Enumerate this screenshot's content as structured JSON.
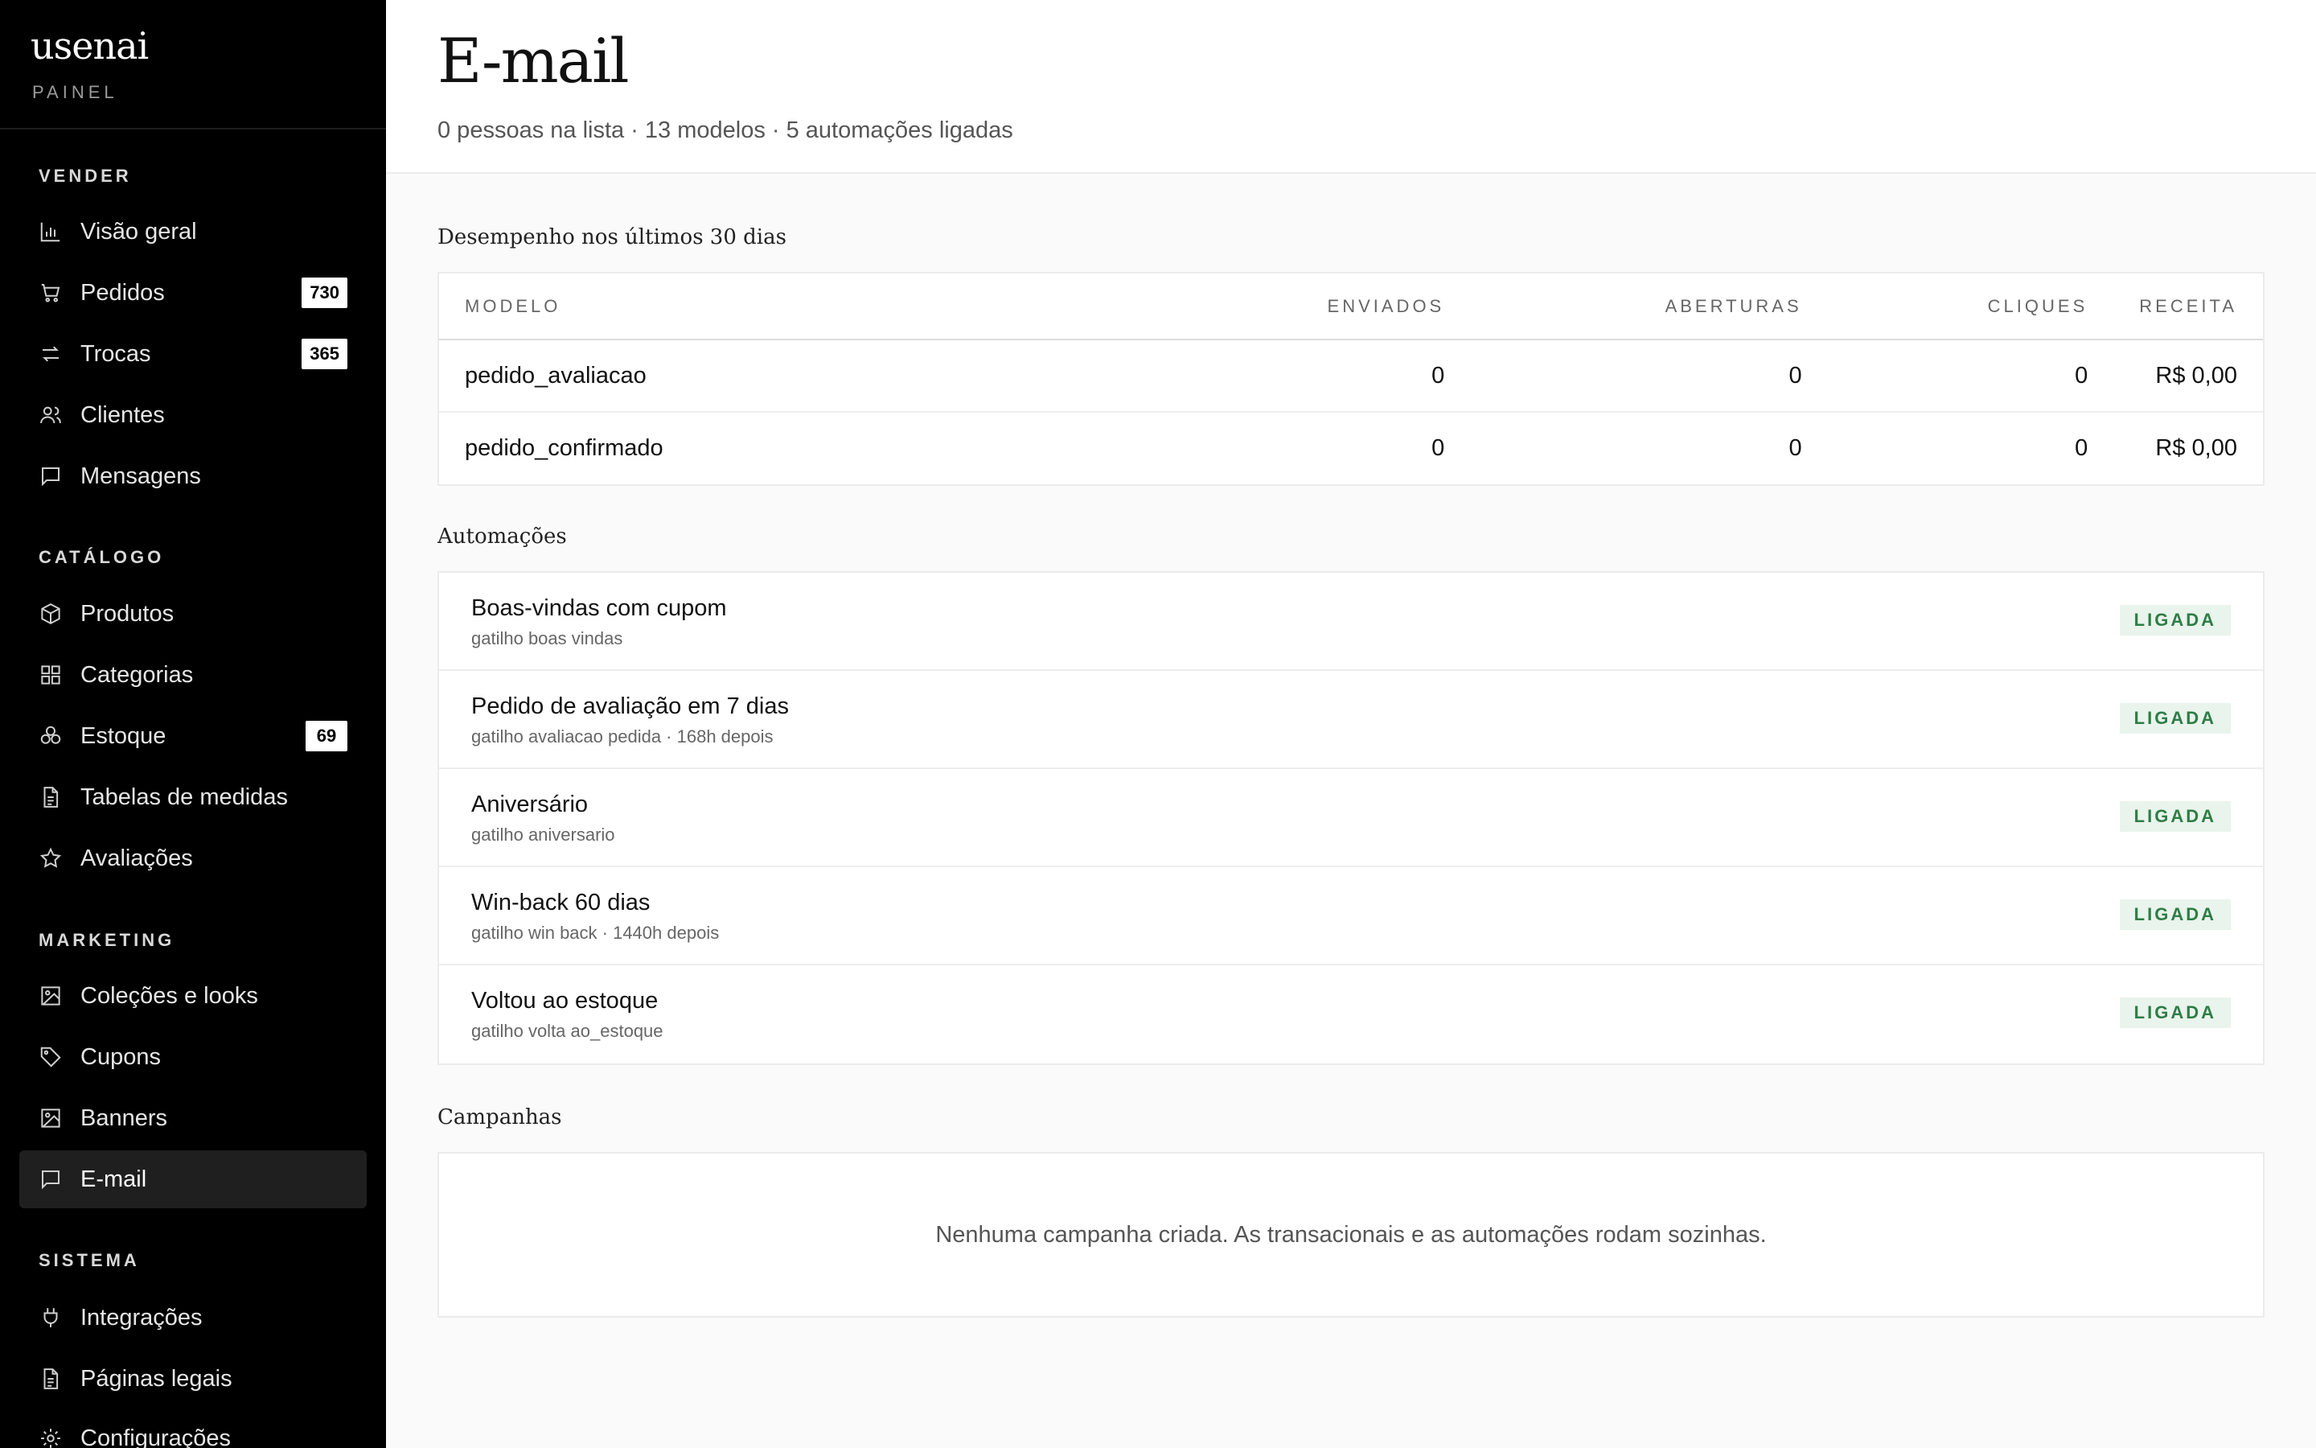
{
  "brand": {
    "logo": "usenai",
    "subtitle": "PAINEL"
  },
  "sidebar": {
    "sections": [
      {
        "title": "VENDER"
      },
      {
        "title": "CATÁLOGO"
      },
      {
        "title": "MARKETING"
      },
      {
        "title": "SISTEMA"
      }
    ],
    "items": [
      {
        "label": "Visão geral",
        "icon": "bar-chart-icon"
      },
      {
        "label": "Pedidos",
        "icon": "cart-icon",
        "badge": "730"
      },
      {
        "label": "Trocas",
        "icon": "exchange-icon",
        "badge": "365"
      },
      {
        "label": "Clientes",
        "icon": "users-icon"
      },
      {
        "label": "Mensagens",
        "icon": "message-icon"
      },
      {
        "label": "Produtos",
        "icon": "box-icon"
      },
      {
        "label": "Categorias",
        "icon": "grid-icon"
      },
      {
        "label": "Estoque",
        "icon": "stack-icon",
        "badge": "69"
      },
      {
        "label": "Tabelas de medidas",
        "icon": "document-icon"
      },
      {
        "label": "Avaliações",
        "icon": "star-icon"
      },
      {
        "label": "Coleções e looks",
        "icon": "image-icon"
      },
      {
        "label": "Cupons",
        "icon": "tag-icon"
      },
      {
        "label": "Banners",
        "icon": "image-icon"
      },
      {
        "label": "E-mail",
        "icon": "message-icon",
        "active": true
      },
      {
        "label": "Integrações",
        "icon": "plug-icon"
      },
      {
        "label": "Páginas legais",
        "icon": "document-icon"
      },
      {
        "label": "Configurações",
        "icon": "gear-icon"
      }
    ]
  },
  "header": {
    "title": "E-mail",
    "subtitle": "0 pessoas na lista · 13 modelos · 5 automações ligadas"
  },
  "performance": {
    "title": "Desempenho nos últimos 30 dias",
    "columns": [
      "MODELO",
      "ENVIADOS",
      "ABERTURAS",
      "CLIQUES",
      "RECEITA"
    ],
    "rows": [
      [
        "pedido_avaliacao",
        "0",
        "0",
        "0",
        "R$ 0,00"
      ],
      [
        "pedido_confirmado",
        "0",
        "0",
        "0",
        "R$ 0,00"
      ]
    ]
  },
  "automations": {
    "title": "Automações",
    "items": [
      {
        "name": "Boas-vindas com cupom",
        "trigger": "gatilho boas vindas",
        "status": "LIGADA"
      },
      {
        "name": "Pedido de avaliação em 7 dias",
        "trigger": "gatilho avaliacao pedida · 168h depois",
        "status": "LIGADA"
      },
      {
        "name": "Aniversário",
        "trigger": "gatilho aniversario",
        "status": "LIGADA"
      },
      {
        "name": "Win-back 60 dias",
        "trigger": "gatilho win back · 1440h depois",
        "status": "LIGADA"
      },
      {
        "name": "Voltou ao estoque",
        "trigger": "gatilho volta ao_estoque",
        "status": "LIGADA"
      }
    ]
  },
  "campaigns": {
    "title": "Campanhas",
    "empty": "Nenhuma campanha criada. As transacionais e as automações rodam sozinhas."
  }
}
